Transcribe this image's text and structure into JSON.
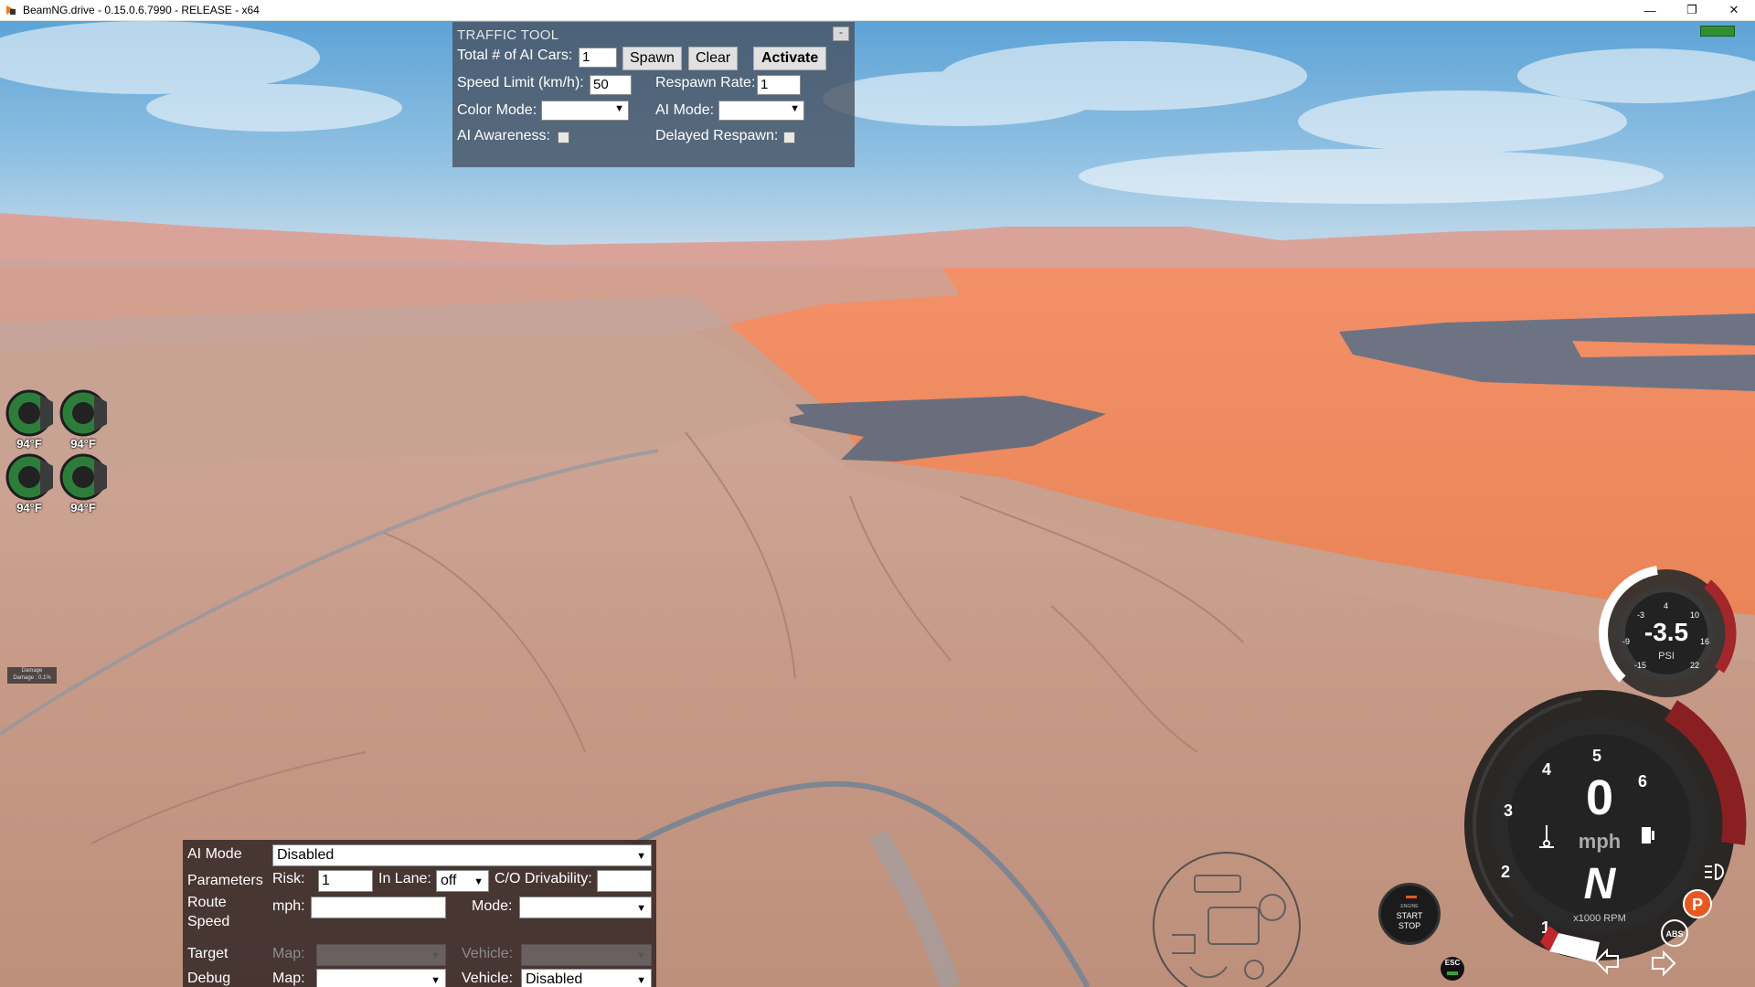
{
  "window": {
    "title": "BeamNG.drive - 0.15.0.6.7990 - RELEASE - x64",
    "minimize": "—",
    "maximize": "❐",
    "close": "✕"
  },
  "traffic_tool": {
    "title": "TRAFFIC TOOL",
    "minimize": "-",
    "total_label": "Total # of AI Cars:",
    "total_value": "1",
    "spawn": "Spawn",
    "clear": "Clear",
    "activate": "Activate",
    "speed_label": "Speed Limit (km/h):",
    "speed_value": "50",
    "respawn_label": "Respawn Rate:",
    "respawn_value": "1",
    "color_mode_label": "Color Mode:",
    "ai_mode_label": "AI Mode:",
    "awareness_label": "AI Awareness:",
    "delayed_label": "Delayed Respawn:"
  },
  "ai_panel": {
    "ai_mode_label": "AI Mode",
    "ai_mode_value": "Disabled",
    "parameters_label": "Parameters",
    "risk_label": "Risk:",
    "risk_value": "1",
    "inlane_label": "In Lane:",
    "inlane_value": "off",
    "drivability_label": "C/O Drivability:",
    "route_label_1": "Route",
    "route_label_2": "Speed",
    "mph_label": "mph:",
    "mode_label": "Mode:",
    "target_label": "Target",
    "target_map_label": "Map:",
    "target_vehicle_label": "Vehicle:",
    "debug_label": "Debug",
    "debug_map_label": "Map:",
    "debug_vehicle_label": "Vehicle:",
    "debug_vehicle_value": "Disabled"
  },
  "brakes": [
    {
      "temp": "94°F"
    },
    {
      "temp": "94°F"
    },
    {
      "temp": "94°F"
    },
    {
      "temp": "94°F"
    }
  ],
  "damage": {
    "title": "Damage",
    "value": "Damage : 0.1%"
  },
  "boost_gauge": {
    "value": "-3.5",
    "unit": "PSI",
    "ticks": [
      "-15",
      "-9",
      "-3",
      "4",
      "10",
      "16",
      "22"
    ]
  },
  "tacho": {
    "speed": "0",
    "unit": "mph",
    "gear": "N",
    "rpm_label": "x1000 RPM",
    "ticks": [
      "1",
      "2",
      "3",
      "4",
      "5",
      "6"
    ],
    "parking": "P",
    "abs": "ABS"
  },
  "engine_button": {
    "top": "ENGINE",
    "line1": "START",
    "line2": "STOP"
  },
  "esc": "ESC",
  "colors": {
    "panel": "#46505f",
    "terrain": "#c9a08e",
    "haze": "#f0845a"
  }
}
